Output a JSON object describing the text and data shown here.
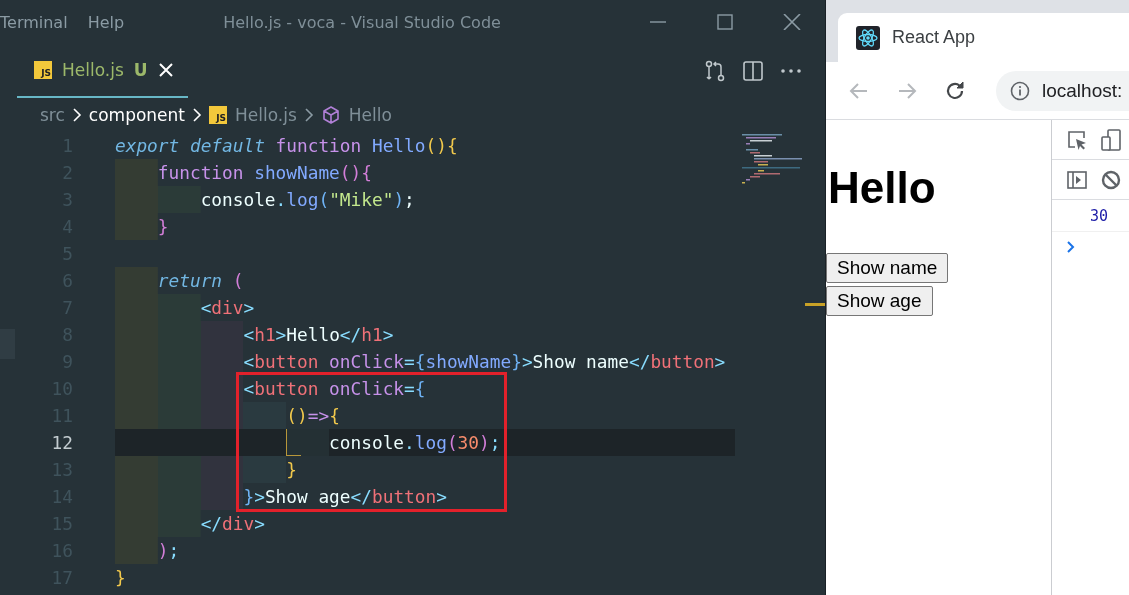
{
  "window": {
    "title": "Hello.js - voca - Visual Studio Code",
    "menu": [
      "Terminal",
      "Help"
    ]
  },
  "editor": {
    "tabs": [
      {
        "label": "Hello.js",
        "icon_label": "JS",
        "git_status": "U",
        "selected": true
      }
    ],
    "breadcrumb": [
      {
        "kind": "folder",
        "label": "src",
        "focused": false
      },
      {
        "kind": "folder",
        "label": "component",
        "focused": true
      },
      {
        "kind": "file",
        "label": "Hello.js",
        "icon_label": "JS",
        "focused": false
      },
      {
        "kind": "symbol",
        "label": "Hello",
        "focused": false
      }
    ],
    "lines": [
      {
        "number": "1",
        "current": false,
        "tokens": [
          {
            "kind": "storage",
            "text": "export default "
          },
          {
            "kind": "keyword",
            "text": "function "
          },
          {
            "kind": "function",
            "text": "Hello"
          },
          {
            "kind": "yellow",
            "text": "(){"
          }
        ]
      },
      {
        "number": "2",
        "current": false,
        "tokens": [
          {
            "kind": "keyword",
            "text": "    function "
          },
          {
            "kind": "function",
            "text": "showName"
          },
          {
            "kind": "purple",
            "text": "(){"
          }
        ]
      },
      {
        "number": "3",
        "current": false,
        "tokens": [
          {
            "kind": "plain",
            "text": "        console"
          },
          {
            "kind": "punct",
            "text": "."
          },
          {
            "kind": "function",
            "text": "log"
          },
          {
            "kind": "blue",
            "text": "("
          },
          {
            "kind": "string",
            "text": "\"Mike\""
          },
          {
            "kind": "blue",
            "text": ")"
          },
          {
            "kind": "plain",
            "text": ";"
          }
        ]
      },
      {
        "number": "4",
        "current": false,
        "tokens": [
          {
            "kind": "purple",
            "text": "    }"
          }
        ]
      },
      {
        "number": "5",
        "current": false
      },
      {
        "number": "6",
        "current": false,
        "tokens": [
          {
            "kind": "storage",
            "text": "    return "
          },
          {
            "kind": "purple",
            "text": "("
          }
        ]
      },
      {
        "number": "7",
        "current": false,
        "tokens": [
          {
            "kind": "punct",
            "text": "        <"
          },
          {
            "kind": "tag",
            "text": "div"
          },
          {
            "kind": "punct",
            "text": ">"
          }
        ]
      },
      {
        "number": "8",
        "current": false,
        "tokens": [
          {
            "kind": "punct",
            "text": "            <"
          },
          {
            "kind": "tag",
            "text": "h1"
          },
          {
            "kind": "punct",
            "text": ">"
          },
          {
            "kind": "plain",
            "text": "Hello"
          },
          {
            "kind": "punct",
            "text": "</"
          },
          {
            "kind": "tag",
            "text": "h1"
          },
          {
            "kind": "punct",
            "text": ">"
          }
        ]
      },
      {
        "number": "9",
        "current": false,
        "tokens": [
          {
            "kind": "punct",
            "text": "            <"
          },
          {
            "kind": "tag",
            "text": "button"
          },
          {
            "kind": "attr",
            "text": " onClick"
          },
          {
            "kind": "punct",
            "text": "="
          },
          {
            "kind": "blue",
            "text": "{"
          },
          {
            "kind": "function",
            "text": "showName"
          },
          {
            "kind": "blue",
            "text": "}"
          },
          {
            "kind": "punct",
            "text": ">"
          },
          {
            "kind": "plain",
            "text": "Show name"
          },
          {
            "kind": "punct",
            "text": "</"
          },
          {
            "kind": "tag",
            "text": "button"
          },
          {
            "kind": "punct",
            "text": ">"
          }
        ]
      },
      {
        "number": "10",
        "current": false,
        "tokens": [
          {
            "kind": "punct",
            "text": "            <"
          },
          {
            "kind": "tag",
            "text": "button"
          },
          {
            "kind": "attr",
            "text": " onClick"
          },
          {
            "kind": "punct",
            "text": "="
          },
          {
            "kind": "blue",
            "text": "{"
          }
        ]
      },
      {
        "number": "11",
        "current": false,
        "tokens": [
          {
            "kind": "yellow",
            "text": "                ()"
          },
          {
            "kind": "keyword",
            "text": "=>"
          },
          {
            "kind": "yellow",
            "text": "{"
          }
        ]
      },
      {
        "number": "12",
        "current": true,
        "tokens": [
          {
            "kind": "plain",
            "text": "                    console"
          },
          {
            "kind": "punct",
            "text": "."
          },
          {
            "kind": "function",
            "text": "log"
          },
          {
            "kind": "purple",
            "text": "("
          },
          {
            "kind": "number",
            "text": "30"
          },
          {
            "kind": "purple",
            "text": ")"
          },
          {
            "kind": "punct",
            "text": ";"
          }
        ]
      },
      {
        "number": "13",
        "current": false,
        "tokens": [
          {
            "kind": "yellow",
            "text": "                }"
          }
        ]
      },
      {
        "number": "14",
        "current": false,
        "tokens": [
          {
            "kind": "blue",
            "text": "            }"
          },
          {
            "kind": "punct",
            "text": ">"
          },
          {
            "kind": "plain",
            "text": "Show age"
          },
          {
            "kind": "punct",
            "text": "</"
          },
          {
            "kind": "tag",
            "text": "button"
          },
          {
            "kind": "punct",
            "text": ">"
          }
        ]
      },
      {
        "number": "15",
        "current": false,
        "tokens": [
          {
            "kind": "punct",
            "text": "        </"
          },
          {
            "kind": "tag",
            "text": "div"
          },
          {
            "kind": "punct",
            "text": ">"
          }
        ]
      },
      {
        "number": "16",
        "current": false,
        "tokens": [
          {
            "kind": "purple",
            "text": "    )"
          },
          {
            "kind": "punct",
            "text": ";"
          }
        ]
      },
      {
        "number": "17",
        "current": false,
        "tokens": [
          {
            "kind": "yellow",
            "text": "}"
          }
        ]
      }
    ]
  },
  "browser": {
    "tabs": [
      {
        "title": "React App",
        "selected": true
      }
    ],
    "nav": [
      {
        "kind": "back",
        "disabled": true
      },
      {
        "kind": "forward",
        "disabled": true
      },
      {
        "kind": "reload",
        "disabled": false
      }
    ],
    "address": "localhost:",
    "page": {
      "heading": "Hello",
      "buttons": [
        "Show name",
        "Show age"
      ]
    },
    "console": {
      "messages": [
        "30"
      ]
    }
  }
}
